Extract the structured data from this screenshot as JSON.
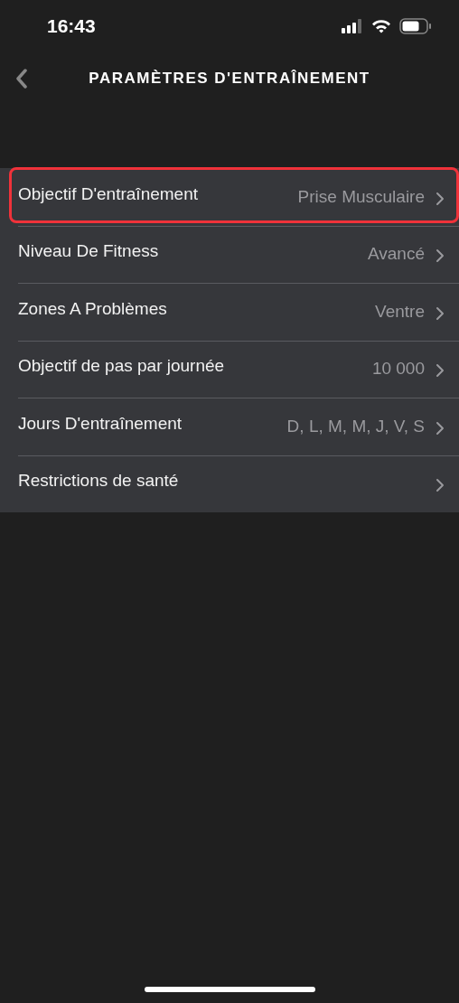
{
  "status_bar": {
    "time": "16:43"
  },
  "nav": {
    "title": "PARAMÈTRES D'ENTRAÎNEMENT"
  },
  "settings": [
    {
      "label": "Objectif D'entraînement",
      "value": "Prise Musculaire",
      "highlighted": true
    },
    {
      "label": "Niveau De Fitness",
      "value": "Avancé",
      "highlighted": false
    },
    {
      "label": "Zones A Problèmes",
      "value": "Ventre",
      "highlighted": false
    },
    {
      "label": "Objectif de pas par journée",
      "value": "10 000",
      "highlighted": false
    },
    {
      "label": "Jours D'entraînement",
      "value": "D, L, M, M, J, V, S",
      "highlighted": false
    },
    {
      "label": "Restrictions de santé",
      "highlighted": false
    }
  ]
}
